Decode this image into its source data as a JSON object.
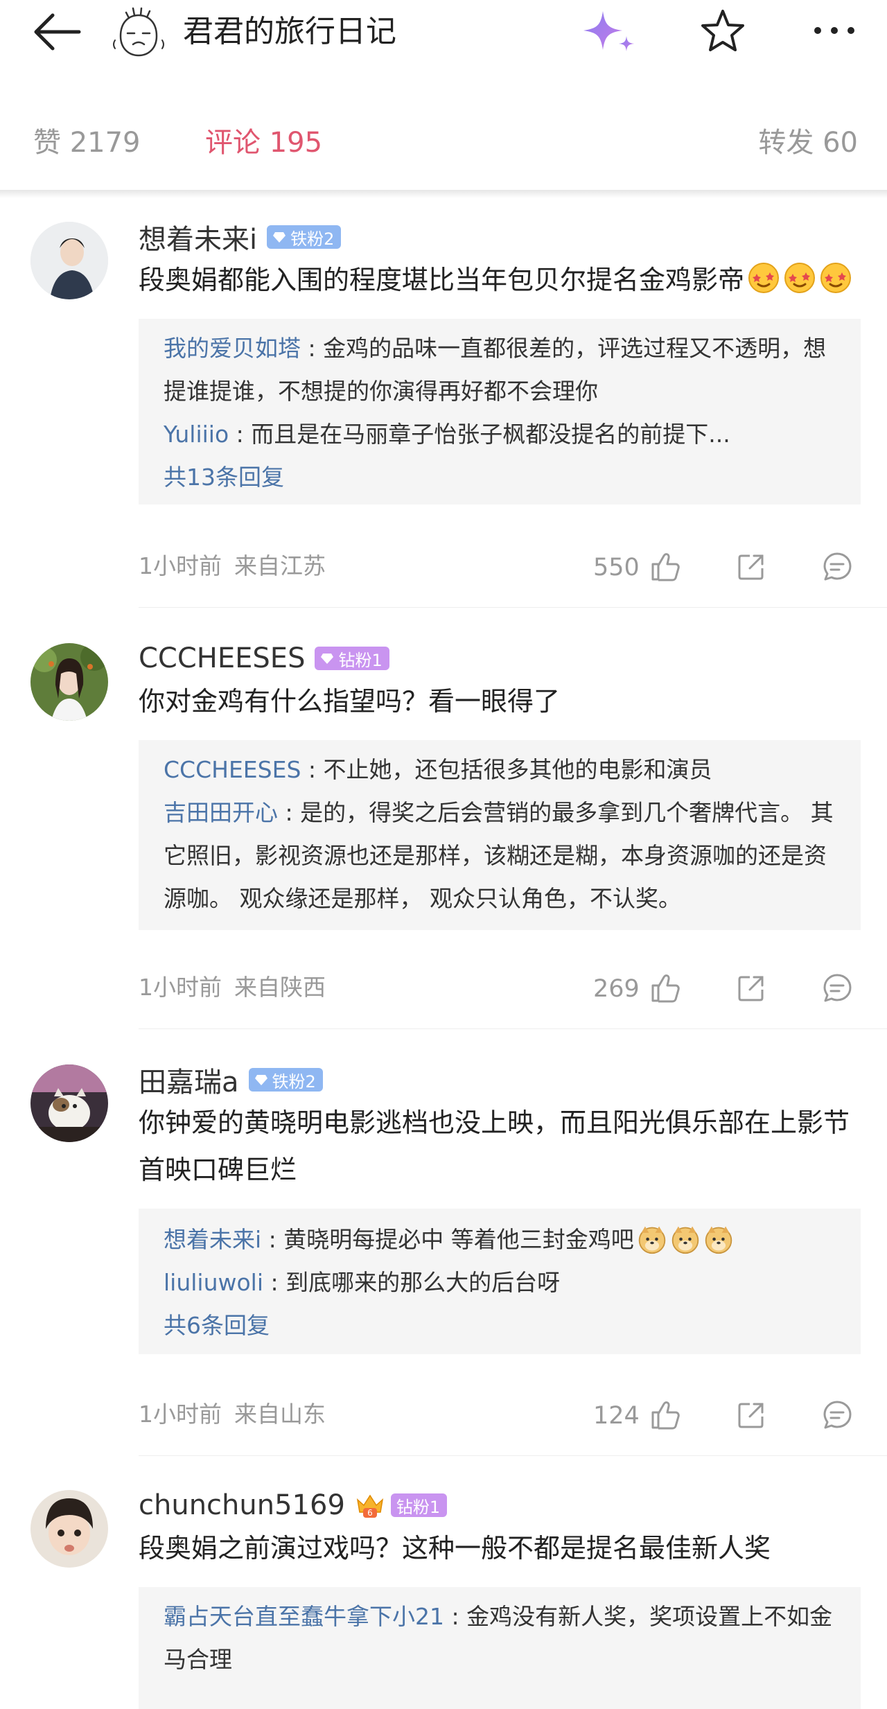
{
  "header": {
    "title": "君君的旅行日记",
    "back_icon": "arrow-left-icon",
    "avatar_icon": "meme-face-avatar",
    "ai_icon": "sparkle-icon",
    "favorite_icon": "star-outline-icon",
    "more_icon": "more-dots-icon"
  },
  "tabs": {
    "likes": "赞 2179",
    "comments": "评论 195",
    "reposts": "转发 60",
    "active_color": "#e0566f"
  },
  "comments": [
    {
      "name": "想着未来i",
      "badge": "铁粉2",
      "text": "段奥娟都能入围的程度堪比当年包贝尔提名金鸡影帝",
      "text_emoji": "starry-eyes-emoji",
      "replies": [
        {
          "name": "我的爱贝如塔",
          "text": "金鸡的品味一直都很差的，评选过程又不透明，想提谁提谁，不想提的你演得再好都不会理你"
        },
        {
          "name": "Yuliiio",
          "text": "而且是在马丽章子怡张子枫都没提名的前提下..."
        }
      ],
      "total": "共13条回复",
      "time": "1小时前",
      "location": "来自江苏",
      "likes": "550"
    },
    {
      "name": "CCCHEESES",
      "badge": "钻粉1",
      "text": "你对金鸡有什么指望吗？看一眼得了",
      "replies": [
        {
          "name": "CCCHEESES",
          "text": "不止她，还包括很多其他的电影和演员"
        },
        {
          "name": "吉田田开心",
          "text": "是的，得奖之后会营销的最多拿到几个奢牌代言。 其它照旧，影视资源也还是那样，该糊还是糊，本身资源咖的还是资源咖。 观众缘还是那样， 观众只认角色，不认奖。"
        }
      ],
      "time": "1小时前",
      "location": "来自陕西",
      "likes": "269"
    },
    {
      "name": "田嘉瑞a",
      "badge": "铁粉2",
      "text": "你钟爱的黄晓明电影逃档也没上映，而且阳光俱乐部在上影节首映口碑巨烂",
      "replies": [
        {
          "name": "想着未来i",
          "text": "黄晓明每提必中 等着他三封金鸡吧",
          "emoji": "doge-emoji"
        },
        {
          "name": "liuliuwoli",
          "text": "到底哪来的那么大的后台呀"
        }
      ],
      "total": "共6条回复",
      "time": "1小时前",
      "location": "来自山东",
      "likes": "124"
    },
    {
      "name": "chunchun5169",
      "badge": "钻粉1",
      "vip_level": "6",
      "text": "段奥娟之前演过戏吗？这种一般不都是提名最佳新人奖",
      "replies": [
        {
          "name": "霸占天台直至蠢牛拿下小21",
          "text": "金鸡没有新人奖，奖项设置上不如金马合理"
        }
      ]
    }
  ],
  "actions": {
    "like_icon": "thumbs-up-icon",
    "share_icon": "share-icon",
    "reply_icon": "comment-icon"
  }
}
